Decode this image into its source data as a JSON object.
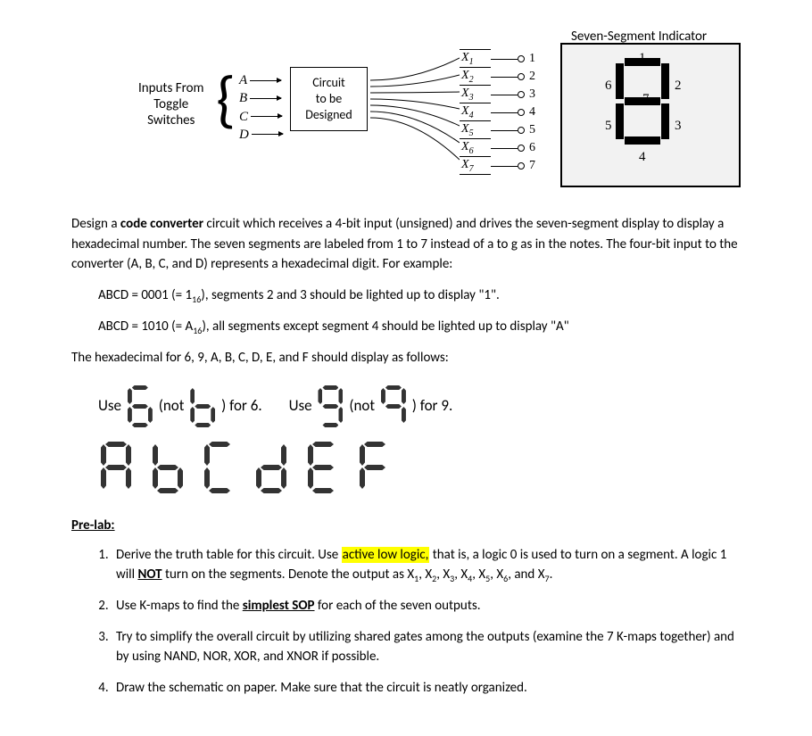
{
  "diagram": {
    "title": "Seven-Segment Indicator",
    "inputs_from": "Inputs From\nToggle\nSwitches",
    "input_letters": [
      "A",
      "B",
      "C",
      "D"
    ],
    "circuit_box": "Circuit\nto be\nDesigned",
    "outputs": [
      {
        "x": "X",
        "sub": "1",
        "num": "1"
      },
      {
        "x": "X",
        "sub": "2",
        "num": "2"
      },
      {
        "x": "X",
        "sub": "3",
        "num": "3"
      },
      {
        "x": "X",
        "sub": "4",
        "num": "4"
      },
      {
        "x": "X",
        "sub": "5",
        "num": "5"
      },
      {
        "x": "X",
        "sub": "6",
        "num": "6"
      },
      {
        "x": "X",
        "sub": "7",
        "num": "7"
      }
    ],
    "seg_labels": {
      "1": "1",
      "2": "2",
      "3": "3",
      "4": "4",
      "5": "5",
      "6": "6",
      "7": "7"
    }
  },
  "p1_a": "Design a ",
  "p1_b": "code converter",
  "p1_c": " circuit which receives a 4-bit input (unsigned) and drives the seven-segment display to display a hexadecimal number.  The seven segments are labeled from 1 to 7 instead of a to g as in the notes. The four-bit input to the converter (A, B, C, and D) represents a hexadecimal digit.  For example:",
  "ex1_a": "ABCD = 0001 (= 1",
  "ex1_sub": "16",
  "ex1_b": "), segments 2 and 3 should be lighted up to display \"1\".",
  "ex2_a": "ABCD = 1010 (= A",
  "ex2_sub": "16",
  "ex2_b": "), all segments except segment 4 should be lighted up to display \"A\"",
  "p2": "The hexadecimal for 6, 9, A, B, C, D, E, and F should display as follows:",
  "use_label": "Use",
  "not_label": "(not",
  "for6": ") for 6.",
  "for9": ") for 9.",
  "prelab": "Pre-lab:",
  "li1_a": "Derive the truth table for this circuit. Use ",
  "li1_hl": "active low logic,",
  "li1_b": " that is, a logic 0 is used to turn on a segment. A logic 1 will ",
  "li1_not": "NOT",
  "li1_c": " turn on the segments. Denote the output as X",
  "li1_d": ", and X",
  "li1_end": ".",
  "outs_subs": [
    "1",
    "2",
    "3",
    "4",
    "5",
    "6",
    "7"
  ],
  "li2_a": "Use K-maps to find the ",
  "li2_b": "simplest SOP",
  "li2_c": " for each of the seven outputs.",
  "li3": "Try to simplify the overall circuit by utilizing shared gates among the outputs (examine the 7 K-maps together) and by using NAND, NOR, XOR, and XNOR if possible.",
  "li4": "Draw the schematic on paper. Make sure that the circuit is neatly organized."
}
